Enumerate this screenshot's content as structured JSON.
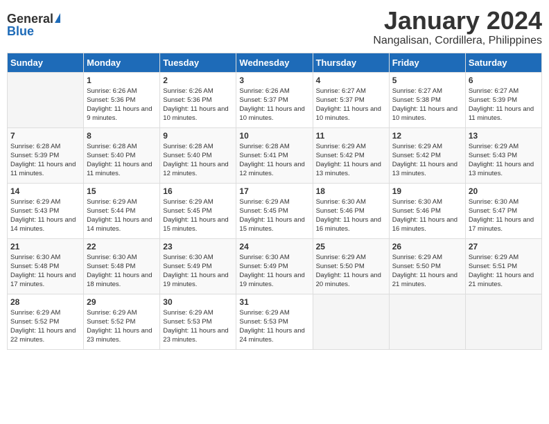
{
  "logo": {
    "general": "General",
    "blue": "Blue"
  },
  "title": "January 2024",
  "subtitle": "Nangalisan, Cordillera, Philippines",
  "headers": [
    "Sunday",
    "Monday",
    "Tuesday",
    "Wednesday",
    "Thursday",
    "Friday",
    "Saturday"
  ],
  "weeks": [
    [
      {
        "day": "",
        "sunrise": "",
        "sunset": "",
        "daylight": ""
      },
      {
        "day": "1",
        "sunrise": "Sunrise: 6:26 AM",
        "sunset": "Sunset: 5:36 PM",
        "daylight": "Daylight: 11 hours and 9 minutes."
      },
      {
        "day": "2",
        "sunrise": "Sunrise: 6:26 AM",
        "sunset": "Sunset: 5:36 PM",
        "daylight": "Daylight: 11 hours and 10 minutes."
      },
      {
        "day": "3",
        "sunrise": "Sunrise: 6:26 AM",
        "sunset": "Sunset: 5:37 PM",
        "daylight": "Daylight: 11 hours and 10 minutes."
      },
      {
        "day": "4",
        "sunrise": "Sunrise: 6:27 AM",
        "sunset": "Sunset: 5:37 PM",
        "daylight": "Daylight: 11 hours and 10 minutes."
      },
      {
        "day": "5",
        "sunrise": "Sunrise: 6:27 AM",
        "sunset": "Sunset: 5:38 PM",
        "daylight": "Daylight: 11 hours and 10 minutes."
      },
      {
        "day": "6",
        "sunrise": "Sunrise: 6:27 AM",
        "sunset": "Sunset: 5:39 PM",
        "daylight": "Daylight: 11 hours and 11 minutes."
      }
    ],
    [
      {
        "day": "7",
        "sunrise": "Sunrise: 6:28 AM",
        "sunset": "Sunset: 5:39 PM",
        "daylight": "Daylight: 11 hours and 11 minutes."
      },
      {
        "day": "8",
        "sunrise": "Sunrise: 6:28 AM",
        "sunset": "Sunset: 5:40 PM",
        "daylight": "Daylight: 11 hours and 11 minutes."
      },
      {
        "day": "9",
        "sunrise": "Sunrise: 6:28 AM",
        "sunset": "Sunset: 5:40 PM",
        "daylight": "Daylight: 11 hours and 12 minutes."
      },
      {
        "day": "10",
        "sunrise": "Sunrise: 6:28 AM",
        "sunset": "Sunset: 5:41 PM",
        "daylight": "Daylight: 11 hours and 12 minutes."
      },
      {
        "day": "11",
        "sunrise": "Sunrise: 6:29 AM",
        "sunset": "Sunset: 5:42 PM",
        "daylight": "Daylight: 11 hours and 13 minutes."
      },
      {
        "day": "12",
        "sunrise": "Sunrise: 6:29 AM",
        "sunset": "Sunset: 5:42 PM",
        "daylight": "Daylight: 11 hours and 13 minutes."
      },
      {
        "day": "13",
        "sunrise": "Sunrise: 6:29 AM",
        "sunset": "Sunset: 5:43 PM",
        "daylight": "Daylight: 11 hours and 13 minutes."
      }
    ],
    [
      {
        "day": "14",
        "sunrise": "Sunrise: 6:29 AM",
        "sunset": "Sunset: 5:43 PM",
        "daylight": "Daylight: 11 hours and 14 minutes."
      },
      {
        "day": "15",
        "sunrise": "Sunrise: 6:29 AM",
        "sunset": "Sunset: 5:44 PM",
        "daylight": "Daylight: 11 hours and 14 minutes."
      },
      {
        "day": "16",
        "sunrise": "Sunrise: 6:29 AM",
        "sunset": "Sunset: 5:45 PM",
        "daylight": "Daylight: 11 hours and 15 minutes."
      },
      {
        "day": "17",
        "sunrise": "Sunrise: 6:29 AM",
        "sunset": "Sunset: 5:45 PM",
        "daylight": "Daylight: 11 hours and 15 minutes."
      },
      {
        "day": "18",
        "sunrise": "Sunrise: 6:30 AM",
        "sunset": "Sunset: 5:46 PM",
        "daylight": "Daylight: 11 hours and 16 minutes."
      },
      {
        "day": "19",
        "sunrise": "Sunrise: 6:30 AM",
        "sunset": "Sunset: 5:46 PM",
        "daylight": "Daylight: 11 hours and 16 minutes."
      },
      {
        "day": "20",
        "sunrise": "Sunrise: 6:30 AM",
        "sunset": "Sunset: 5:47 PM",
        "daylight": "Daylight: 11 hours and 17 minutes."
      }
    ],
    [
      {
        "day": "21",
        "sunrise": "Sunrise: 6:30 AM",
        "sunset": "Sunset: 5:48 PM",
        "daylight": "Daylight: 11 hours and 17 minutes."
      },
      {
        "day": "22",
        "sunrise": "Sunrise: 6:30 AM",
        "sunset": "Sunset: 5:48 PM",
        "daylight": "Daylight: 11 hours and 18 minutes."
      },
      {
        "day": "23",
        "sunrise": "Sunrise: 6:30 AM",
        "sunset": "Sunset: 5:49 PM",
        "daylight": "Daylight: 11 hours and 19 minutes."
      },
      {
        "day": "24",
        "sunrise": "Sunrise: 6:30 AM",
        "sunset": "Sunset: 5:49 PM",
        "daylight": "Daylight: 11 hours and 19 minutes."
      },
      {
        "day": "25",
        "sunrise": "Sunrise: 6:29 AM",
        "sunset": "Sunset: 5:50 PM",
        "daylight": "Daylight: 11 hours and 20 minutes."
      },
      {
        "day": "26",
        "sunrise": "Sunrise: 6:29 AM",
        "sunset": "Sunset: 5:50 PM",
        "daylight": "Daylight: 11 hours and 21 minutes."
      },
      {
        "day": "27",
        "sunrise": "Sunrise: 6:29 AM",
        "sunset": "Sunset: 5:51 PM",
        "daylight": "Daylight: 11 hours and 21 minutes."
      }
    ],
    [
      {
        "day": "28",
        "sunrise": "Sunrise: 6:29 AM",
        "sunset": "Sunset: 5:52 PM",
        "daylight": "Daylight: 11 hours and 22 minutes."
      },
      {
        "day": "29",
        "sunrise": "Sunrise: 6:29 AM",
        "sunset": "Sunset: 5:52 PM",
        "daylight": "Daylight: 11 hours and 23 minutes."
      },
      {
        "day": "30",
        "sunrise": "Sunrise: 6:29 AM",
        "sunset": "Sunset: 5:53 PM",
        "daylight": "Daylight: 11 hours and 23 minutes."
      },
      {
        "day": "31",
        "sunrise": "Sunrise: 6:29 AM",
        "sunset": "Sunset: 5:53 PM",
        "daylight": "Daylight: 11 hours and 24 minutes."
      },
      {
        "day": "",
        "sunrise": "",
        "sunset": "",
        "daylight": ""
      },
      {
        "day": "",
        "sunrise": "",
        "sunset": "",
        "daylight": ""
      },
      {
        "day": "",
        "sunrise": "",
        "sunset": "",
        "daylight": ""
      }
    ]
  ]
}
